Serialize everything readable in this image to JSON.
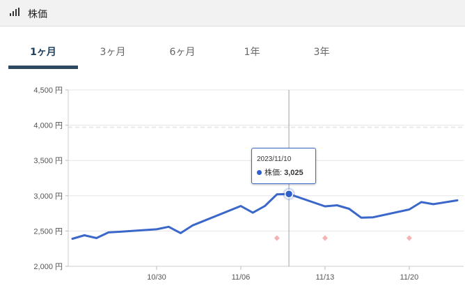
{
  "header": {
    "title": "株価",
    "icon": "signal-bars-icon"
  },
  "tabs": [
    {
      "label": "1ヶ月",
      "active": true
    },
    {
      "label": "3ヶ月",
      "active": false
    },
    {
      "label": "6ヶ月",
      "active": false
    },
    {
      "label": "1年",
      "active": false
    },
    {
      "label": "3年",
      "active": false
    }
  ],
  "tooltip": {
    "date": "2023/11/10",
    "series_label": "株価",
    "value": "3,025"
  },
  "colors": {
    "line": "#3a67c9",
    "marker": "#f4b3b3",
    "accent": "#2d4860"
  },
  "chart_data": {
    "type": "line",
    "title": "",
    "xlabel": "",
    "ylabel": "",
    "ylim": [
      2000,
      4500
    ],
    "y_ticks": [
      {
        "value": 2000,
        "label": "2,000 円"
      },
      {
        "value": 2500,
        "label": "2,500 円"
      },
      {
        "value": 3000,
        "label": "3,000 円"
      },
      {
        "value": 3500,
        "label": "3,500 円"
      },
      {
        "value": 4000,
        "label": "4,000 円"
      },
      {
        "value": 4500,
        "label": "4,500 円"
      }
    ],
    "x_ticks": [
      {
        "date": "2023-10-30",
        "label": "10/30"
      },
      {
        "date": "2023-11-06",
        "label": "11/06"
      },
      {
        "date": "2023-11-13",
        "label": "11/13"
      },
      {
        "date": "2023-11-20",
        "label": "11/20"
      }
    ],
    "x_range": [
      "2023-10-23",
      "2023-11-24"
    ],
    "dashed_reference_y": 3970,
    "grid": true,
    "series": [
      {
        "name": "株価",
        "points": [
          {
            "date": "2023-10-23",
            "value": 2390
          },
          {
            "date": "2023-10-24",
            "value": 2440
          },
          {
            "date": "2023-10-25",
            "value": 2400
          },
          {
            "date": "2023-10-26",
            "value": 2480
          },
          {
            "date": "2023-10-27",
            "value": 2490
          },
          {
            "date": "2023-10-30",
            "value": 2525
          },
          {
            "date": "2023-10-31",
            "value": 2560
          },
          {
            "date": "2023-11-01",
            "value": 2470
          },
          {
            "date": "2023-11-02",
            "value": 2580
          },
          {
            "date": "2023-11-06",
            "value": 2855
          },
          {
            "date": "2023-11-07",
            "value": 2760
          },
          {
            "date": "2023-11-08",
            "value": 2855
          },
          {
            "date": "2023-11-09",
            "value": 3020
          },
          {
            "date": "2023-11-10",
            "value": 3025
          },
          {
            "date": "2023-11-13",
            "value": 2850
          },
          {
            "date": "2023-11-14",
            "value": 2865
          },
          {
            "date": "2023-11-15",
            "value": 2815
          },
          {
            "date": "2023-11-16",
            "value": 2690
          },
          {
            "date": "2023-11-17",
            "value": 2695
          },
          {
            "date": "2023-11-20",
            "value": 2805
          },
          {
            "date": "2023-11-21",
            "value": 2910
          },
          {
            "date": "2023-11-22",
            "value": 2880
          },
          {
            "date": "2023-11-24",
            "value": 2935
          }
        ]
      }
    ],
    "event_markers": [
      {
        "date": "2023-11-09",
        "value": 2400
      },
      {
        "date": "2023-11-13",
        "value": 2400
      },
      {
        "date": "2023-11-20",
        "value": 2400
      }
    ],
    "highlight": {
      "date": "2023-11-10",
      "value": 3025
    }
  }
}
